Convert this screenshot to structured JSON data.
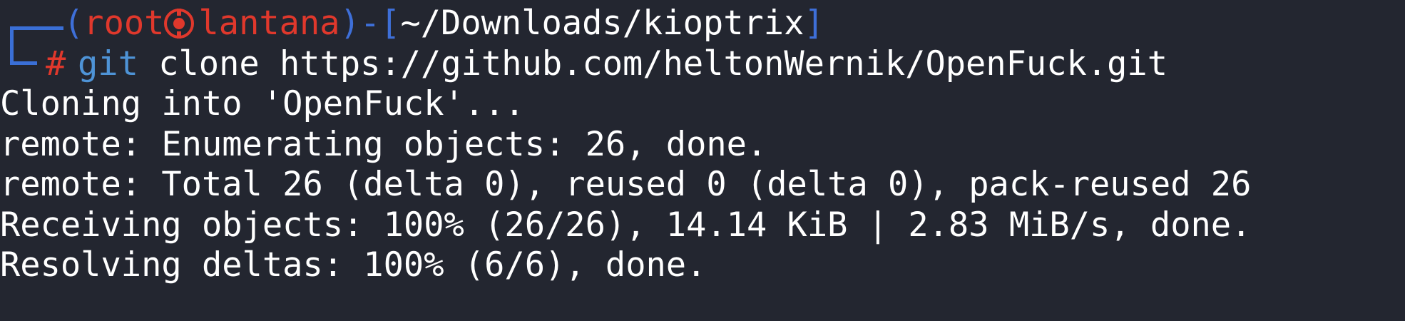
{
  "colors": {
    "background": "#232630",
    "prompt_frame": "#3e6fd8",
    "user_host": "#e0382c",
    "command": "#4e93d6",
    "text": "#ffffff"
  },
  "prompt": {
    "open_paren": "(",
    "user": "root",
    "separator_icon": "kali-skull-icon",
    "host": "lantana",
    "close_paren": ")",
    "dash": "-",
    "open_bracket": "[",
    "cwd": "~/Downloads/kioptrix",
    "close_bracket": "]",
    "symbol": "#"
  },
  "command": {
    "program": "git",
    "args": "clone https://github.com/heltonWernik/OpenFuck.git"
  },
  "output": [
    "Cloning into 'OpenFuck'...",
    "remote: Enumerating objects: 26, done.",
    "remote: Total 26 (delta 0), reused 0 (delta 0), pack-reused 26",
    "Receiving objects: 100% (26/26), 14.14 KiB | 2.83 MiB/s, done.",
    "Resolving deltas: 100% (6/6), done."
  ]
}
